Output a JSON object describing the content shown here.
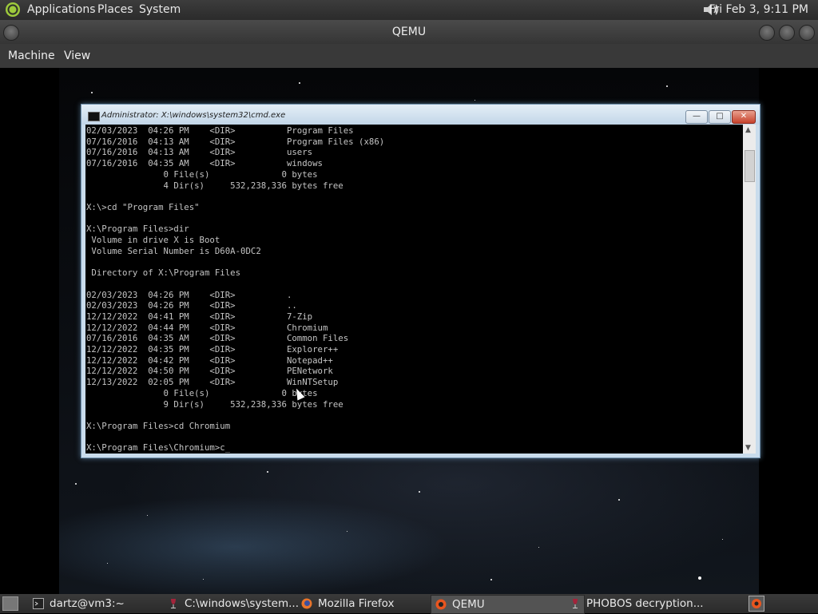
{
  "top_panel": {
    "applications": "Applications",
    "places": "Places",
    "system": "System",
    "clock": "Fri Feb  3,  9:11 PM",
    "volume_icon": "volume-icon"
  },
  "qemu": {
    "title": "QEMU",
    "menu": {
      "machine": "Machine",
      "view": "View"
    }
  },
  "cmd": {
    "title": "Administrator: X:\\windows\\system32\\cmd.exe",
    "minimize": "—",
    "maximize": "□",
    "close": "✕",
    "output": "02/03/2023  04:26 PM    <DIR>          Program Files\n07/16/2016  04:13 AM    <DIR>          Program Files (x86)\n07/16/2016  04:13 AM    <DIR>          users\n07/16/2016  04:35 AM    <DIR>          windows\n               0 File(s)              0 bytes\n               4 Dir(s)     532,238,336 bytes free\n\nX:\\>cd \"Program Files\"\n\nX:\\Program Files>dir\n Volume in drive X is Boot\n Volume Serial Number is D60A-0DC2\n\n Directory of X:\\Program Files\n\n02/03/2023  04:26 PM    <DIR>          .\n02/03/2023  04:26 PM    <DIR>          ..\n12/12/2022  04:41 PM    <DIR>          7-Zip\n12/12/2022  04:44 PM    <DIR>          Chromium\n07/16/2016  04:35 AM    <DIR>          Common Files\n12/12/2022  04:35 PM    <DIR>          Explorer++\n12/12/2022  04:42 PM    <DIR>          Notepad++\n12/12/2022  04:50 PM    <DIR>          PENetwork\n12/13/2022  02:05 PM    <DIR>          WinNTSetup\n               0 File(s)              0 bytes\n               9 Dir(s)     532,238,336 bytes free\n\nX:\\Program Files>cd Chromium\n\nX:\\Program Files\\Chromium>c_"
  },
  "taskbar": {
    "items": [
      {
        "label": "dartz@vm3:~",
        "icon": "terminal-icon"
      },
      {
        "label": "C:\\windows\\system...",
        "icon": "wine-icon"
      },
      {
        "label": "Mozilla Firefox",
        "icon": "firefox-icon"
      },
      {
        "label": "QEMU",
        "icon": "qemu-icon"
      },
      {
        "label": "PHOBOS decryption...",
        "icon": "wine-icon"
      }
    ]
  },
  "colors": {
    "console_bg": "#000000",
    "console_text": "#c4c4c4",
    "aero_frame": "#c9dcec",
    "panel_bg": "#2b2b2b"
  }
}
